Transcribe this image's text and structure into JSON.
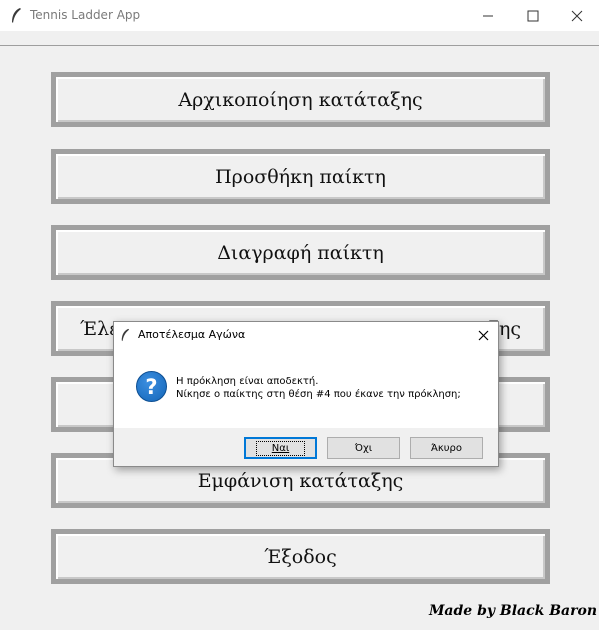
{
  "window": {
    "title": "Tennis Ladder App",
    "icons": [
      "feather-icon",
      "minimize-icon",
      "maximize-icon",
      "close-icon"
    ]
  },
  "menu": {
    "buttons": [
      {
        "label": "Αρχικοποίηση κατάταξης"
      },
      {
        "label": "Προσθήκη παίκτη"
      },
      {
        "label": "Διαγραφή παίκτη"
      },
      {
        "label": "Έλε"
      },
      {
        "label": ""
      },
      {
        "label": "Εμφάνιση κατάταξης"
      },
      {
        "label": "Έξοδος"
      }
    ],
    "hidden_fragment_right": "ξης"
  },
  "credit": "Made by Black Baron",
  "dialog": {
    "title": "Αποτέλεσμα Αγώνα",
    "icon": "question-icon",
    "message_line1": "Η πρόκληση είναι αποδεκτή.",
    "message_line2": "Νίκησε ο παίκτης στη θέση #4 που έκανε την πρόκληση;",
    "yes_label": "Ναι",
    "no_label": "Όχι",
    "cancel_label": "Άκυρο"
  },
  "colors": {
    "background": "#f0f0f0",
    "button_border": "#a0a0a0",
    "accent": "#0078d7",
    "question_icon": "#1466b8"
  }
}
